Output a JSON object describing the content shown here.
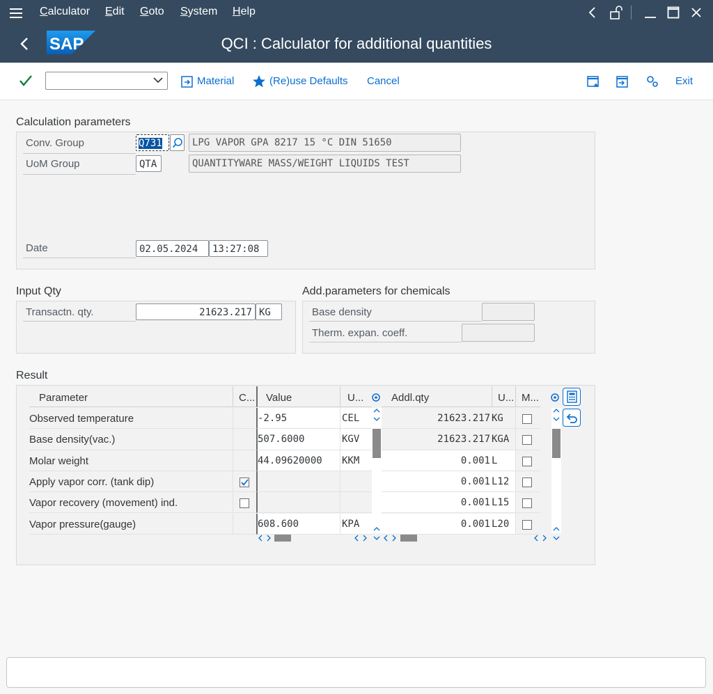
{
  "menu": {
    "items": [
      "Calculator",
      "Edit",
      "Goto",
      "System",
      "Help"
    ]
  },
  "title": "QCI : Calculator for additional quantities",
  "logo_text": "SAP",
  "toolbar": {
    "material_label": "Material",
    "reuse_label": "(Re)use Defaults",
    "cancel_label": "Cancel",
    "exit_label": "Exit",
    "command_value": ""
  },
  "calc_params": {
    "title": "Calculation parameters",
    "conv_group_label": "Conv. Group",
    "conv_group_value": "Q731",
    "conv_group_desc": "LPG VAPOR GPA 8217 15 °C DIN 51650",
    "uom_group_label": "UoM Group",
    "uom_group_value": "QTA",
    "uom_group_desc": "QUANTITYWARE MASS/WEIGHT LIQUIDS TEST",
    "date_label": "Date",
    "date_value": "02.05.2024",
    "time_value": "13:27:08"
  },
  "input_qty": {
    "title": "Input Qty",
    "label": "Transactn. qty.",
    "value": "21623.217",
    "unit": "KG"
  },
  "chem_params": {
    "title": "Add.parameters for chemicals",
    "base_density_label": "Base density",
    "base_density_value": "",
    "therm_label": "Therm. expan. coeff.",
    "therm_value": ""
  },
  "result": {
    "title": "Result",
    "left_headers": {
      "param": "Parameter",
      "c": "C...",
      "value": "Value",
      "u": "U..."
    },
    "right_headers": {
      "addl": "Addl.qty",
      "u": "U...",
      "m": "M..."
    },
    "rows": [
      {
        "param": "Observed temperature",
        "check": "none",
        "value": "-2.95",
        "unit": "CEL"
      },
      {
        "param": "Base density(vac.)",
        "check": "none",
        "value": "507.6000",
        "unit": "KGV"
      },
      {
        "param": "Molar weight",
        "check": "none",
        "value": "44.09620000",
        "unit": "KKM"
      },
      {
        "param": "Apply vapor corr. (tank dip)",
        "check": "checked",
        "value": "",
        "unit": ""
      },
      {
        "param": "Vapor recovery (movement) ind.",
        "check": "unchecked",
        "value": "",
        "unit": ""
      },
      {
        "param": "Vapor pressure(gauge)",
        "check": "none",
        "value": "608.600",
        "unit": "KPA"
      }
    ],
    "addl_rows": [
      {
        "qty": "21623.217",
        "unit": "KG"
      },
      {
        "qty": "21623.217",
        "unit": "KGA"
      },
      {
        "qty": "0.001",
        "unit": "L"
      },
      {
        "qty": "0.001",
        "unit": "L12"
      },
      {
        "qty": "0.001",
        "unit": "L15"
      },
      {
        "qty": "0.001",
        "unit": "L20"
      }
    ]
  },
  "colors": {
    "shell": "#354a5f",
    "accent": "#0a6ed1",
    "check": "#107e3e"
  }
}
